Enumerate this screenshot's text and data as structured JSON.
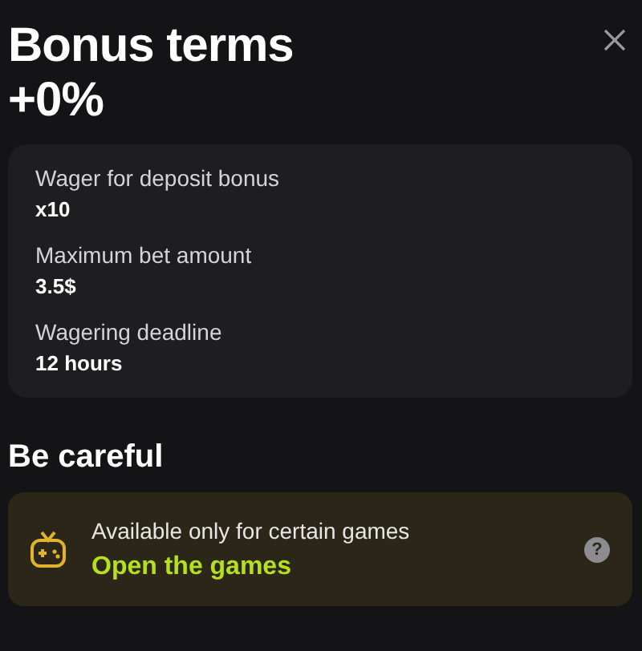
{
  "title": "Bonus terms",
  "subtitle": "+0%",
  "terms": [
    {
      "label": "Wager for deposit bonus",
      "value": "x10"
    },
    {
      "label": "Maximum bet amount",
      "value": "3.5$"
    },
    {
      "label": "Wagering deadline",
      "value": "12 hours"
    }
  ],
  "section_title": "Be careful",
  "notice": {
    "text": "Available only for certain games",
    "link": "Open the games",
    "help": "?"
  }
}
